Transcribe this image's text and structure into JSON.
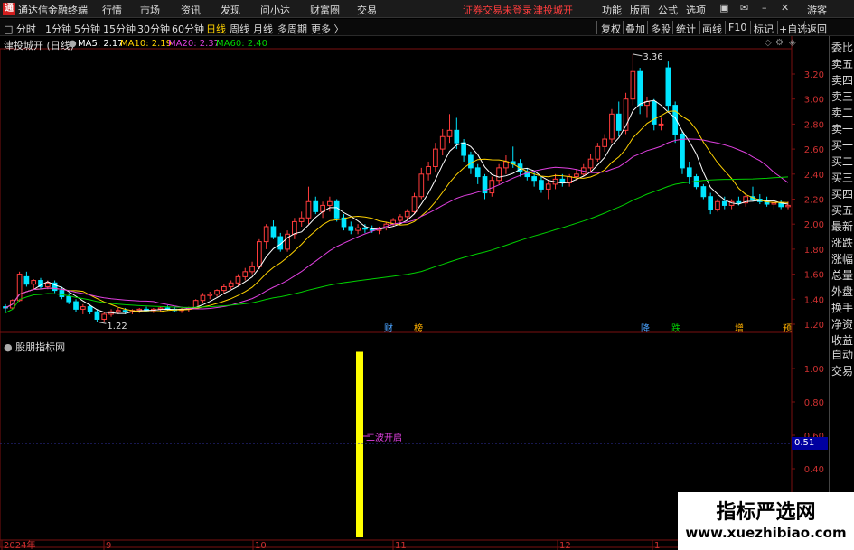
{
  "titlebar": {
    "logo": "通",
    "app_name": "通达信金融终端",
    "menu": [
      "行情",
      "市场",
      "资讯",
      "发现",
      "问小达",
      "财富圈",
      "交易"
    ],
    "notice": "证券交易未登录",
    "stock_name": "津投城开",
    "right_menu": [
      "功能",
      "版面",
      "公式",
      "选项"
    ],
    "user": "游客"
  },
  "toolbar": {
    "periods": [
      "分时",
      "1分钟",
      "5分钟",
      "15分钟",
      "30分钟",
      "60分钟",
      "日线",
      "周线",
      "月线",
      "多周期",
      "更多 〉"
    ],
    "active_period": "日线",
    "right_tools": [
      "复权",
      "叠加",
      "多股",
      "统计",
      "画线",
      "F10",
      "标记",
      "+自选",
      "返回"
    ]
  },
  "main_chart": {
    "stock_label": "津投城开 (日线)",
    "ma_legend": [
      {
        "label": "MA5: 2.17",
        "color": "#ffffff"
      },
      {
        "label": "MA10: 2.19",
        "color": "#ffd200"
      },
      {
        "label": "MA20: 2.37",
        "color": "#e040e0"
      },
      {
        "label": "MA60: 2.40",
        "color": "#00d000"
      }
    ],
    "y_ticks": [
      "3.20",
      "3.00",
      "2.80",
      "2.60",
      "2.40",
      "2.20",
      "2.00",
      "1.80",
      "1.60",
      "1.40",
      "1.20"
    ],
    "high_mark": "3.36",
    "low_mark": "1.22",
    "event_tags": [
      {
        "label": "财",
        "color": "#4aa3ff"
      },
      {
        "label": "榜",
        "color": "#ffb000"
      },
      {
        "label": "降",
        "color": "#4aa3ff"
      },
      {
        "label": "跌",
        "color": "#00d000"
      },
      {
        "label": "增",
        "color": "#ffb000"
      },
      {
        "label": "预",
        "color": "#ffb000"
      }
    ]
  },
  "indicator": {
    "title": "股朋指标网",
    "signal_label": "二波开启",
    "y_ticks": [
      "1.00",
      "0.80",
      "0.60",
      "0.40"
    ],
    "current_value": "0.51",
    "bar_color": "#ffff00"
  },
  "x_axis": {
    "labels": [
      "2024年",
      "9",
      "10",
      "11",
      "12",
      "1"
    ]
  },
  "side_panel": {
    "items": [
      "委比",
      "卖五",
      "卖四",
      "卖三",
      "卖二",
      "卖一",
      "买一",
      "买二",
      "买三",
      "买四",
      "买五",
      "最新",
      "涨跌",
      "涨幅",
      "总量",
      "外盘",
      "换手",
      "净资",
      "收益",
      "自动",
      "交易"
    ]
  },
  "watermark": {
    "title": "指标严选网",
    "url": "www.xuezhibiao.com"
  },
  "colors": {
    "up": "#ff3c3c",
    "down": "#00e5ff",
    "ma5": "#ffffff",
    "ma10": "#ffd200",
    "ma20": "#e040e0",
    "ma60": "#00d000",
    "grid": "#7a1010"
  },
  "chart_data": {
    "type": "candlestick",
    "y_range": [
      1.1,
      3.45
    ],
    "candles": [
      [
        1.34,
        1.36,
        1.3,
        1.33
      ],
      [
        1.33,
        1.4,
        1.32,
        1.39
      ],
      [
        1.39,
        1.62,
        1.38,
        1.6
      ],
      [
        1.58,
        1.62,
        1.5,
        1.52
      ],
      [
        1.52,
        1.56,
        1.48,
        1.55
      ],
      [
        1.55,
        1.57,
        1.48,
        1.5
      ],
      [
        1.5,
        1.55,
        1.48,
        1.53
      ],
      [
        1.53,
        1.55,
        1.45,
        1.47
      ],
      [
        1.47,
        1.5,
        1.4,
        1.42
      ],
      [
        1.42,
        1.45,
        1.36,
        1.38
      ],
      [
        1.38,
        1.4,
        1.3,
        1.32
      ],
      [
        1.32,
        1.36,
        1.28,
        1.34
      ],
      [
        1.34,
        1.36,
        1.28,
        1.3
      ],
      [
        1.3,
        1.32,
        1.22,
        1.24
      ],
      [
        1.24,
        1.3,
        1.22,
        1.28
      ],
      [
        1.28,
        1.32,
        1.26,
        1.3
      ],
      [
        1.3,
        1.33,
        1.28,
        1.31
      ],
      [
        1.31,
        1.33,
        1.28,
        1.3
      ],
      [
        1.3,
        1.32,
        1.28,
        1.31
      ],
      [
        1.31,
        1.33,
        1.29,
        1.32
      ],
      [
        1.32,
        1.34,
        1.3,
        1.31
      ],
      [
        1.31,
        1.33,
        1.29,
        1.32
      ],
      [
        1.32,
        1.34,
        1.3,
        1.33
      ],
      [
        1.33,
        1.35,
        1.31,
        1.32
      ],
      [
        1.32,
        1.34,
        1.3,
        1.31
      ],
      [
        1.31,
        1.33,
        1.29,
        1.32
      ],
      [
        1.32,
        1.34,
        1.3,
        1.33
      ],
      [
        1.33,
        1.4,
        1.32,
        1.39
      ],
      [
        1.39,
        1.45,
        1.37,
        1.43
      ],
      [
        1.43,
        1.46,
        1.4,
        1.44
      ],
      [
        1.44,
        1.48,
        1.42,
        1.47
      ],
      [
        1.47,
        1.52,
        1.45,
        1.5
      ],
      [
        1.5,
        1.55,
        1.48,
        1.53
      ],
      [
        1.53,
        1.6,
        1.5,
        1.58
      ],
      [
        1.58,
        1.65,
        1.55,
        1.62
      ],
      [
        1.62,
        1.7,
        1.6,
        1.66
      ],
      [
        1.66,
        1.88,
        1.64,
        1.86
      ],
      [
        1.86,
        2.0,
        1.8,
        1.98
      ],
      [
        1.98,
        2.03,
        1.88,
        1.9
      ],
      [
        1.9,
        1.93,
        1.78,
        1.8
      ],
      [
        1.8,
        1.95,
        1.78,
        1.92
      ],
      [
        1.92,
        2.05,
        1.88,
        2.02
      ],
      [
        2.02,
        2.1,
        1.98,
        2.05
      ],
      [
        2.05,
        2.3,
        2.0,
        2.18
      ],
      [
        2.18,
        2.22,
        2.08,
        2.1
      ],
      [
        2.1,
        2.18,
        2.05,
        2.15
      ],
      [
        2.15,
        2.22,
        2.1,
        2.18
      ],
      [
        2.18,
        2.2,
        2.02,
        2.05
      ],
      [
        2.05,
        2.08,
        1.95,
        1.98
      ],
      [
        1.98,
        2.02,
        1.92,
        1.95
      ],
      [
        1.95,
        2.0,
        1.92,
        1.97
      ],
      [
        1.97,
        2.0,
        1.93,
        1.96
      ],
      [
        1.96,
        1.99,
        1.93,
        1.95
      ],
      [
        1.95,
        1.98,
        1.92,
        1.97
      ],
      [
        1.97,
        2.02,
        1.95,
        2.0
      ],
      [
        2.0,
        2.05,
        1.98,
        2.03
      ],
      [
        2.03,
        2.08,
        2.0,
        2.06
      ],
      [
        2.06,
        2.12,
        2.03,
        2.1
      ],
      [
        2.1,
        2.25,
        2.08,
        2.22
      ],
      [
        2.22,
        2.45,
        2.2,
        2.4
      ],
      [
        2.4,
        2.5,
        2.35,
        2.46
      ],
      [
        2.46,
        2.65,
        2.42,
        2.6
      ],
      [
        2.6,
        2.76,
        2.55,
        2.7
      ],
      [
        2.7,
        2.88,
        2.65,
        2.75
      ],
      [
        2.75,
        2.85,
        2.6,
        2.65
      ],
      [
        2.65,
        2.68,
        2.5,
        2.55
      ],
      [
        2.55,
        2.58,
        2.4,
        2.45
      ],
      [
        2.45,
        2.48,
        2.32,
        2.38
      ],
      [
        2.38,
        2.4,
        2.2,
        2.25
      ],
      [
        2.25,
        2.38,
        2.22,
        2.35
      ],
      [
        2.35,
        2.48,
        2.32,
        2.45
      ],
      [
        2.45,
        2.55,
        2.4,
        2.5
      ],
      [
        2.5,
        2.62,
        2.45,
        2.48
      ],
      [
        2.48,
        2.52,
        2.38,
        2.42
      ],
      [
        2.42,
        2.45,
        2.35,
        2.38
      ],
      [
        2.38,
        2.42,
        2.3,
        2.35
      ],
      [
        2.35,
        2.38,
        2.25,
        2.28
      ],
      [
        2.28,
        2.35,
        2.2,
        2.32
      ],
      [
        2.32,
        2.4,
        2.28,
        2.36
      ],
      [
        2.36,
        2.4,
        2.3,
        2.33
      ],
      [
        2.33,
        2.4,
        2.3,
        2.38
      ],
      [
        2.38,
        2.44,
        2.35,
        2.4
      ],
      [
        2.4,
        2.48,
        2.38,
        2.45
      ],
      [
        2.45,
        2.56,
        2.42,
        2.52
      ],
      [
        2.52,
        2.65,
        2.5,
        2.62
      ],
      [
        2.62,
        2.72,
        2.58,
        2.68
      ],
      [
        2.68,
        2.92,
        2.65,
        2.88
      ],
      [
        2.88,
        2.98,
        2.7,
        2.75
      ],
      [
        2.75,
        3.05,
        2.72,
        3.0
      ],
      [
        3.0,
        3.36,
        2.95,
        3.22
      ],
      [
        3.22,
        3.25,
        2.88,
        2.95
      ],
      [
        2.95,
        3.02,
        2.85,
        2.98
      ],
      [
        2.98,
        3.0,
        2.75,
        2.8
      ],
      [
        2.8,
        2.85,
        2.75,
        2.8
      ],
      [
        3.25,
        3.3,
        2.9,
        2.95
      ],
      [
        2.95,
        2.98,
        2.65,
        2.72
      ],
      [
        2.72,
        2.75,
        2.4,
        2.45
      ],
      [
        2.45,
        2.5,
        2.32,
        2.38
      ],
      [
        2.38,
        2.4,
        2.28,
        2.3
      ],
      [
        2.3,
        2.32,
        2.2,
        2.22
      ],
      [
        2.22,
        2.25,
        2.08,
        2.12
      ],
      [
        2.12,
        2.2,
        2.1,
        2.18
      ],
      [
        2.18,
        2.22,
        2.12,
        2.15
      ],
      [
        2.15,
        2.2,
        2.12,
        2.18
      ],
      [
        2.18,
        2.22,
        2.15,
        2.17
      ],
      [
        2.17,
        2.25,
        2.14,
        2.22
      ],
      [
        2.22,
        2.3,
        2.18,
        2.2
      ],
      [
        2.2,
        2.24,
        2.16,
        2.18
      ],
      [
        2.18,
        2.22,
        2.14,
        2.16
      ],
      [
        2.16,
        2.2,
        2.12,
        2.17
      ],
      [
        2.17,
        2.19,
        2.12,
        2.14
      ],
      [
        2.14,
        2.18,
        2.12,
        2.15
      ]
    ],
    "ma_values": {
      "ma5_end": 2.17,
      "ma10_end": 2.19,
      "ma20_end": 2.37,
      "ma60_end": 2.4
    },
    "indicator_bar": {
      "value": 1.1,
      "x_fraction": 0.47
    }
  }
}
